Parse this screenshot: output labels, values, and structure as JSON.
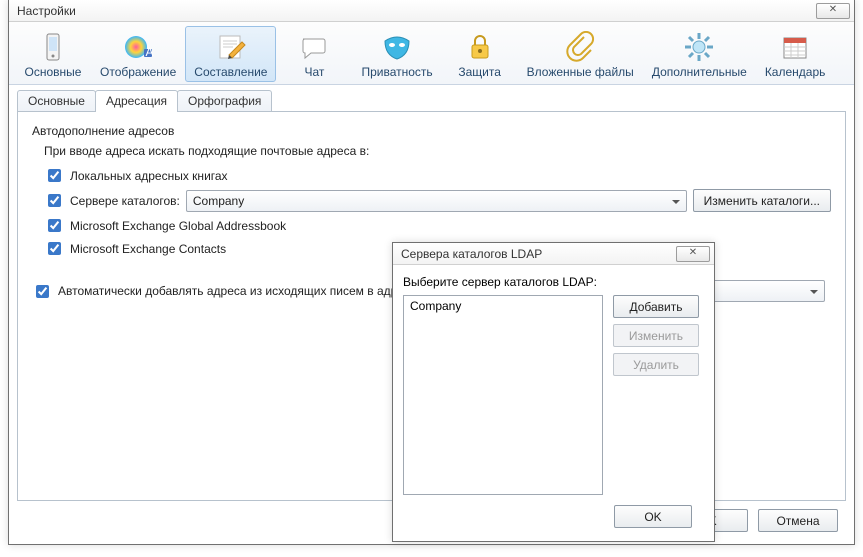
{
  "main": {
    "title": "Настройки",
    "ok": "OK",
    "cancel": "Отмена"
  },
  "toolbar": {
    "items": [
      "Основные",
      "Отображение",
      "Составление",
      "Чат",
      "Приватность",
      "Защита",
      "Вложенные файлы",
      "Дополнительные",
      "Календарь"
    ]
  },
  "tabs": [
    "Основные",
    "Адресация",
    "Орфография"
  ],
  "page": {
    "group": "Автодополнение адресов",
    "hint": "При вводе адреса искать подходящие почтовые адреса в:",
    "cb_local": "Локальных адресных книгах",
    "cb_dir": "Сервере каталогов:",
    "dir_selected": "Company",
    "btn_edit_dirs": "Изменить каталоги...",
    "cb_gal": "Microsoft Exchange Global Addressbook",
    "cb_contacts": "Microsoft Exchange Contacts",
    "cb_auto_add": "Автоматически добавлять адреса из исходящих писем в адр"
  },
  "dialog": {
    "title": "Сервера каталогов LDAP",
    "hint": "Выберите сервер каталогов LDAP:",
    "items": [
      "Company"
    ],
    "btn_add": "Добавить",
    "btn_edit": "Изменить",
    "btn_del": "Удалить",
    "ok": "OK"
  }
}
